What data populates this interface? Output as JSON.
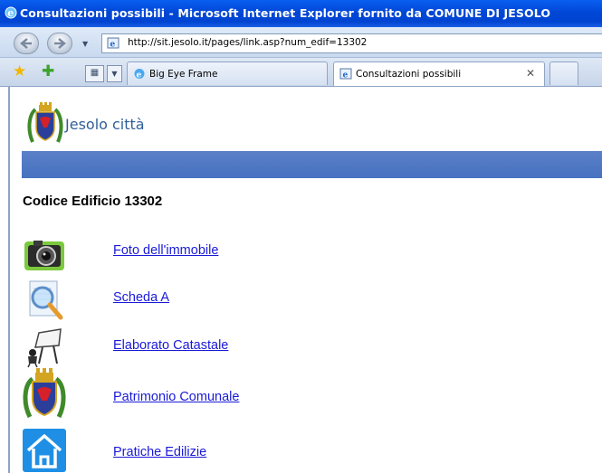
{
  "window": {
    "title": "Consultazioni possibili - Microsoft Internet Explorer fornito da COMUNE DI JESOLO"
  },
  "address_bar": {
    "url": "http://sit.jesolo.it/pages/link.asp?num_edif=13302"
  },
  "tabs": [
    {
      "label": "Big Eye Frame",
      "active": false
    },
    {
      "label": "Consultazioni possibili",
      "active": true
    }
  ],
  "page": {
    "site_name": "Jesolo città",
    "heading": "Codice Edificio 13302",
    "band_color": "#4f78c4",
    "links": [
      {
        "label": "Foto dell'immobile",
        "icon": "camera-icon"
      },
      {
        "label": "Scheda A",
        "icon": "magnifier-document-icon"
      },
      {
        "label": "Elaborato Catastale",
        "icon": "drafting-table-icon"
      },
      {
        "label": "Patrimonio Comunale",
        "icon": "coat-of-arms-icon"
      },
      {
        "label": "Pratiche Edilizie",
        "icon": "house-icon"
      }
    ]
  }
}
